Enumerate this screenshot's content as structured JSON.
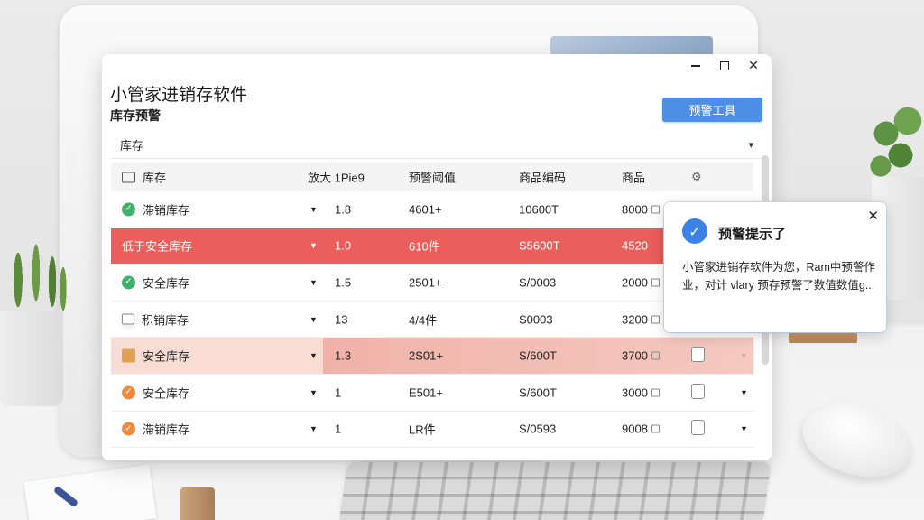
{
  "window": {
    "title": "小管家进销存软件",
    "subtitle": "库存预警",
    "alert_tool_label": "预警工具",
    "category_select": {
      "value": "库存"
    }
  },
  "table": {
    "columns": {
      "name": "库存",
      "ratio": "放大 1Pie9",
      "threshold": "预警阈值",
      "code": "商品编码",
      "qty": "商品"
    },
    "rows": [
      {
        "status": "滞销库存",
        "ratio": "1.8",
        "threshold": "4601+",
        "code": "10600T",
        "qty": "8000",
        "icon": "check-circle-icon"
      },
      {
        "status": "低于安全库存",
        "ratio": "1.0",
        "threshold": "610件",
        "code": "S5600T",
        "qty": "4520",
        "icon": "none"
      },
      {
        "status": "安全库存",
        "ratio": "1.5",
        "threshold": "2501+",
        "code": "S/0003",
        "qty": "2000",
        "icon": "check-circle-icon"
      },
      {
        "status": "积销库存",
        "ratio": "13",
        "threshold": "4/4件",
        "code": "S0003",
        "qty": "3200",
        "icon": "monitor-icon"
      },
      {
        "status": "安全库存",
        "ratio": "1.3",
        "threshold": "2S01+",
        "code": "S/600T",
        "qty": "3700",
        "icon": "box-icon"
      },
      {
        "status": "安全库存",
        "ratio": "1",
        "threshold": "E501+",
        "code": "S/600T",
        "qty": "3000",
        "icon": "warning-circle-icon"
      },
      {
        "status": "滞销库存",
        "ratio": "1",
        "threshold": "LR件",
        "code": "S/0593",
        "qty": "9008",
        "icon": "warning-circle-icon"
      }
    ]
  },
  "toast": {
    "title": "预警提示了",
    "message": "小管家进销存软件为您，Ram中预警作业，对计 vlary 预存预警了数值数值g..."
  },
  "colors": {
    "accent": "#4d8ee6",
    "danger_row": "#ea5e5b",
    "warn_row": "#f5c9c0",
    "ok_icon": "#3fb06a"
  }
}
